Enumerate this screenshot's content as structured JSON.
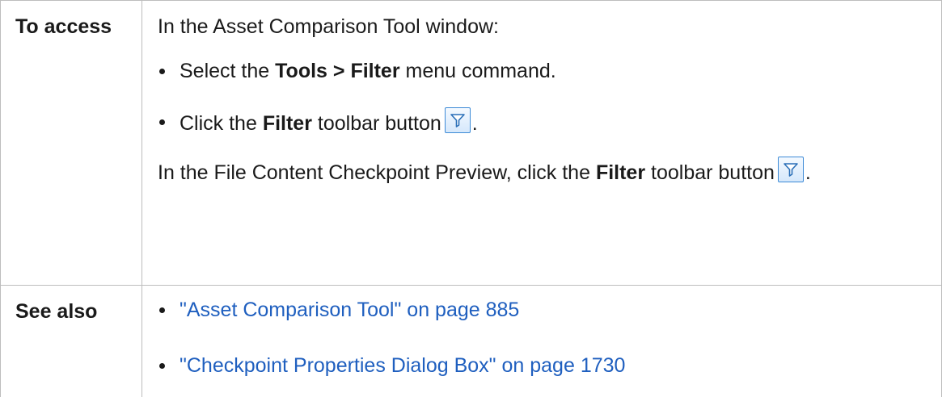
{
  "access": {
    "label": "To access",
    "intro": "In the Asset Comparison Tool window:",
    "items": [
      {
        "pre": "Select the ",
        "bold": "Tools > Filter",
        "post": " menu command."
      },
      {
        "pre": "Click the ",
        "bold": "Filter",
        "post": " toolbar button",
        "end": "."
      }
    ],
    "para2": {
      "pre": "In the File Content Checkpoint Preview, click the ",
      "bold": "Filter",
      "post": " toolbar button",
      "end": "."
    },
    "icon": "filter-funnel-icon"
  },
  "see_also": {
    "label": "See also",
    "links": [
      "\"Asset Comparison Tool\" on page 885",
      "\"Checkpoint Properties Dialog Box\" on page 1730"
    ]
  },
  "colors": {
    "link": "#1f5fbf",
    "border": "#bdbdbd",
    "icon_border": "#3c8ad6"
  }
}
